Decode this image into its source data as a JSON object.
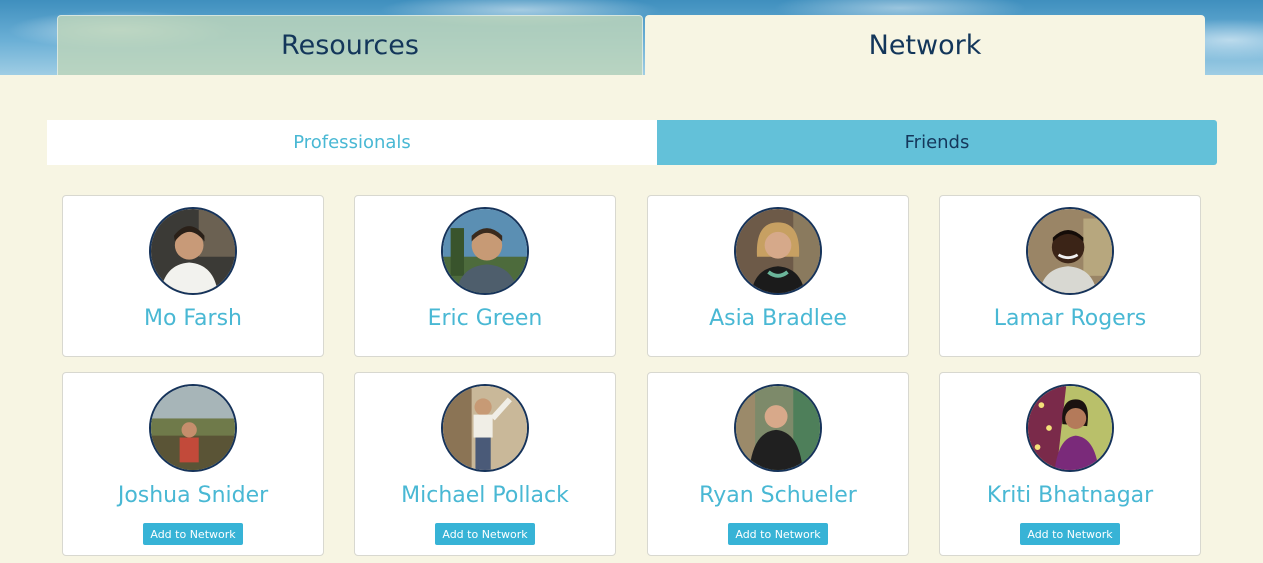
{
  "top_tabs": {
    "resources_label": "Resources",
    "network_label": "Network"
  },
  "segments": {
    "professionals_label": "Professionals",
    "friends_label": "Friends"
  },
  "cards": [
    {
      "name": "Mo Farsh"
    },
    {
      "name": "Eric Green"
    },
    {
      "name": "Asia Bradlee"
    },
    {
      "name": "Lamar Rogers"
    },
    {
      "name": "Joshua Snider",
      "button": "Add to Network"
    },
    {
      "name": "Michael Pollack",
      "button": "Add to Network"
    },
    {
      "name": "Ryan Schueler",
      "button": "Add to Network"
    },
    {
      "name": "Kriti Bhatnagar",
      "button": "Add to Network"
    }
  ],
  "colors": {
    "page_background": "#f7f5e3",
    "accent_text": "#49b8d4",
    "active_segment": "#63c1d9",
    "add_button": "#37b3d6",
    "navy": "#13365a"
  }
}
